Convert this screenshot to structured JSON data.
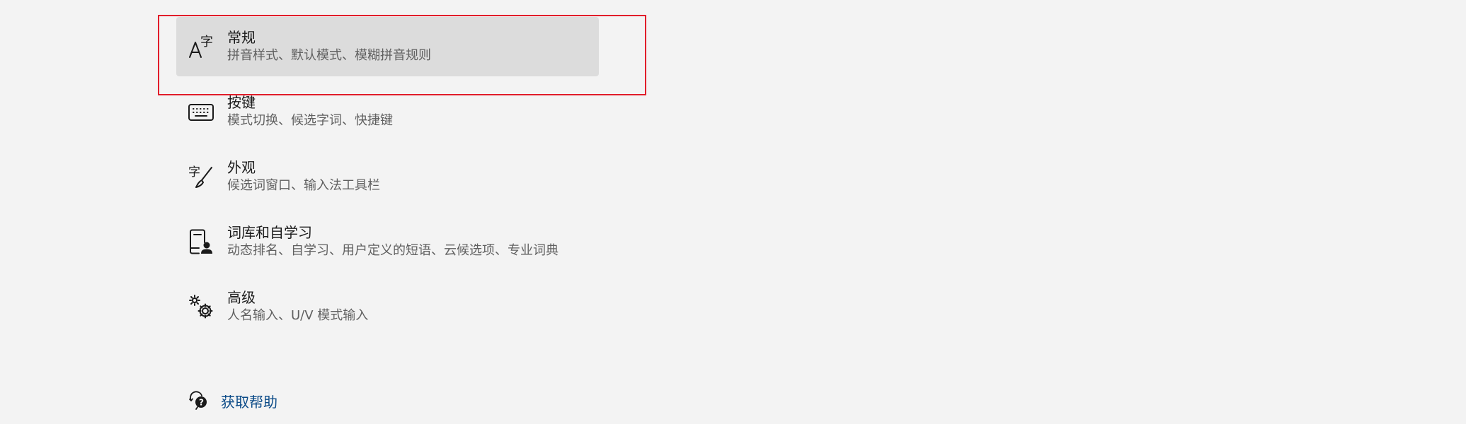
{
  "settings": {
    "items": [
      {
        "title": "常规",
        "description": "拼音样式、默认模式、模糊拼音规则",
        "icon": "font-a-zi-icon",
        "selected": true
      },
      {
        "title": "按键",
        "description": "模式切换、候选字词、快捷键",
        "icon": "keyboard-icon",
        "selected": false
      },
      {
        "title": "外观",
        "description": "候选词窗口、输入法工具栏",
        "icon": "brush-zi-icon",
        "selected": false
      },
      {
        "title": "词库和自学习",
        "description": "动态排名、自学习、用户定义的短语、云候选项、专业词典",
        "icon": "dictionary-person-icon",
        "selected": false
      },
      {
        "title": "高级",
        "description": "人名输入、U/V 模式输入",
        "icon": "gears-icon",
        "selected": false
      }
    ]
  },
  "help": {
    "label": "获取帮助",
    "icon": "help-chat-icon"
  },
  "colors": {
    "background": "#f3f3f3",
    "selected_background": "#dcdcdc",
    "highlight_border": "#e11d2a",
    "link": "#0a4a87"
  }
}
